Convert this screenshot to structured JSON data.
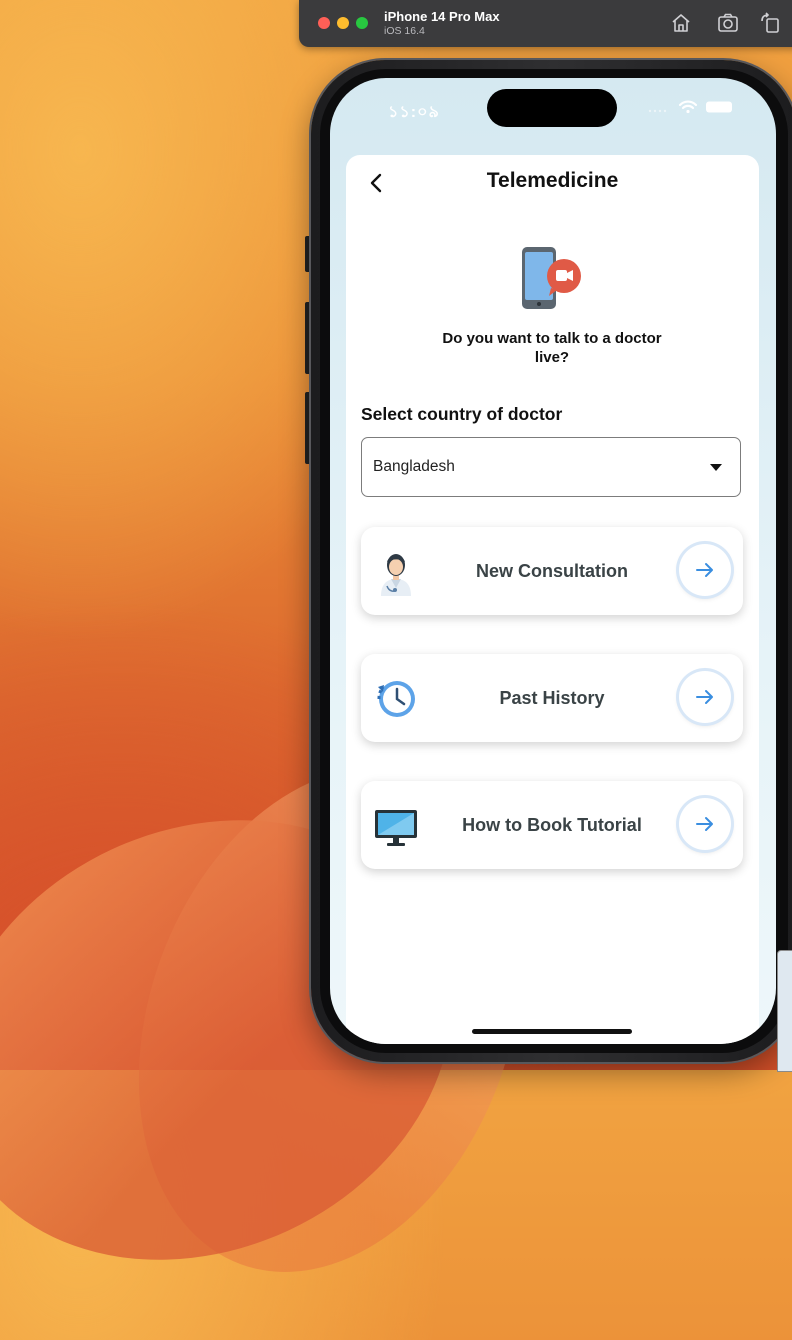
{
  "simulator": {
    "device_name": "iPhone 14 Pro Max",
    "os_version": "iOS 16.4",
    "buttons": [
      "home-icon",
      "screenshot-icon",
      "rotate-icon"
    ]
  },
  "status_bar": {
    "time": "১১:০৯"
  },
  "header": {
    "title": "Telemedicine",
    "back_icon": "chevron-left-icon"
  },
  "hero": {
    "icon": "phone-video-call-icon",
    "question": "Do you want to talk to a doctor live?"
  },
  "country_select": {
    "label": "Select country of doctor",
    "selected": "Bangladesh"
  },
  "options": [
    {
      "label": "New Consultation",
      "icon": "doctor-icon"
    },
    {
      "label": "Past History",
      "icon": "history-clock-icon"
    },
    {
      "label": "How to Book Tutorial",
      "icon": "monitor-icon"
    }
  ],
  "colors": {
    "accent_blue": "#3a8ee0",
    "screen_bg": "#d5e9f1",
    "text_dark": "#111111",
    "option_text": "#3a4346"
  }
}
